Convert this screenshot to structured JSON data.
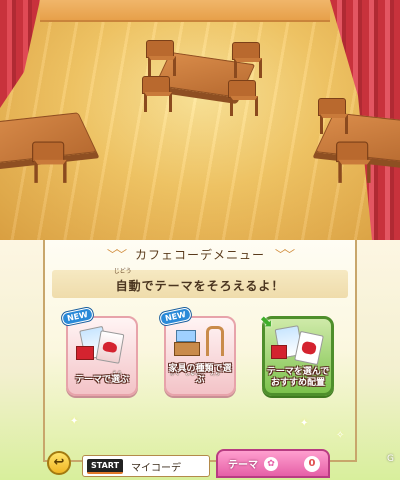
{
  "menu": {
    "title": "カフェコーデメニュー",
    "subtitle": "自動でテーマをそろえるよ！",
    "subtitle_ruby": "じどう"
  },
  "options": [
    {
      "label_line1": "テーマで選ぶ",
      "label_line2": "",
      "ruby": "えら",
      "badge": "NEW",
      "state": "normal"
    },
    {
      "label_line1": "家具の種類で選ぶ",
      "label_line2": "",
      "ruby": "かぐ　しゅるい　えら",
      "badge": "NEW",
      "state": "normal"
    },
    {
      "label_line1": "テーマを選んで",
      "label_line2": "おすすめ配置",
      "ruby": "はいち",
      "badge": "",
      "state": "selected"
    }
  ],
  "footer": {
    "start_key": "START",
    "start_label": "マイコーデ",
    "theme_label": "テーマ",
    "theme_count": "0"
  },
  "watermark": "G"
}
